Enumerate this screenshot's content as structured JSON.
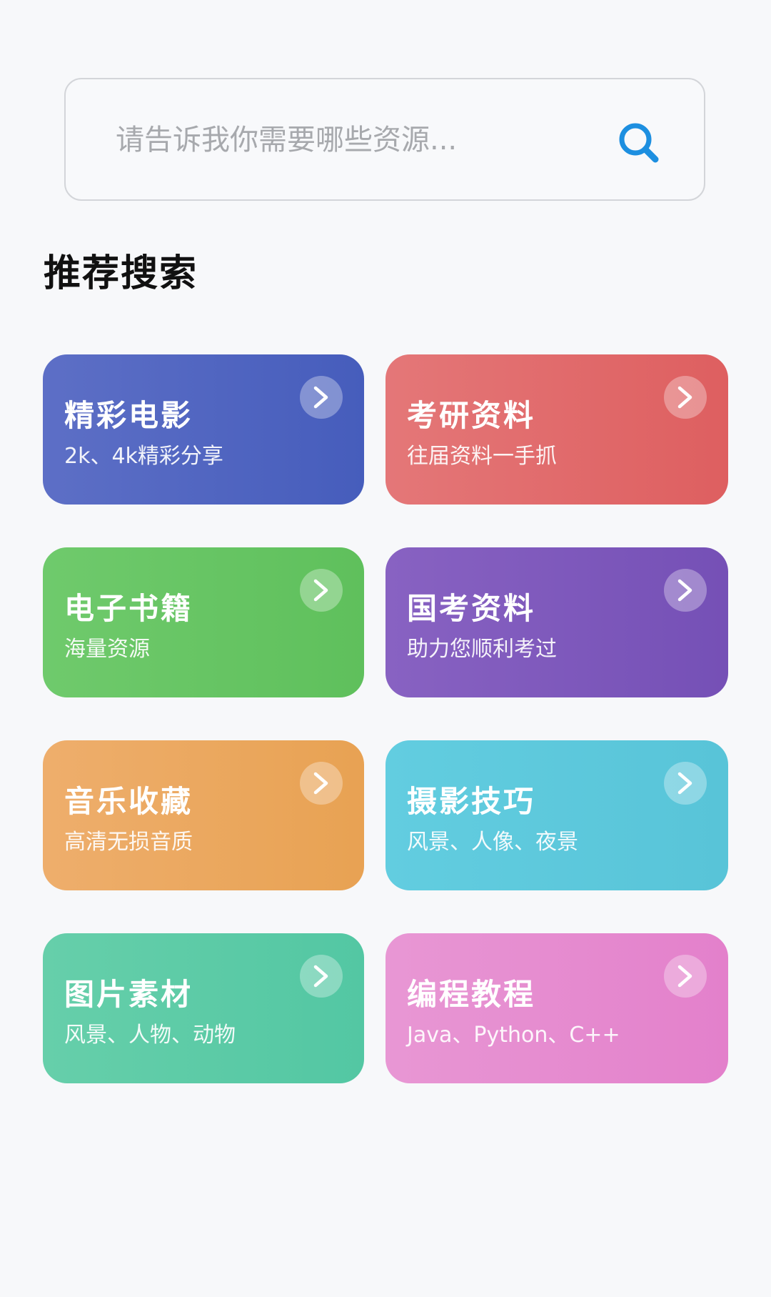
{
  "search": {
    "placeholder": "请告诉我你需要哪些资源..."
  },
  "section": {
    "title": "推荐搜索"
  },
  "cards": [
    {
      "title": "精彩电影",
      "subtitle": "2k、4k精彩分享",
      "color_start": "#5d6fc6",
      "color_end": "#465dbc"
    },
    {
      "title": "考研资料",
      "subtitle": "往届资料一手抓",
      "color_start": "#e47778",
      "color_end": "#de5f60"
    },
    {
      "title": "电子书籍",
      "subtitle": "海量资源",
      "color_start": "#6fca6c",
      "color_end": "#5fc05c"
    },
    {
      "title": "国考资料",
      "subtitle": "助力您顺利考过",
      "color_start": "#8862c2",
      "color_end": "#7550b6"
    },
    {
      "title": "音乐收藏",
      "subtitle": "高清无损音质",
      "color_start": "#eeae6c",
      "color_end": "#e8a253"
    },
    {
      "title": "摄影技巧",
      "subtitle": "风景、人像、夜景",
      "color_start": "#62cde0",
      "color_end": "#58c4d8"
    },
    {
      "title": "图片素材",
      "subtitle": "风景、人物、动物",
      "color_start": "#66cfaa",
      "color_end": "#53c7a3"
    },
    {
      "title": "编程教程",
      "subtitle": "Java、Python、C++",
      "color_start": "#e897d4",
      "color_end": "#e380cb"
    }
  ],
  "colors": {
    "background": "#f7f8fa",
    "search_icon": "#1d8fe0"
  },
  "icons": {
    "search": "search-icon",
    "card_arrow": "chevron-right-icon"
  }
}
